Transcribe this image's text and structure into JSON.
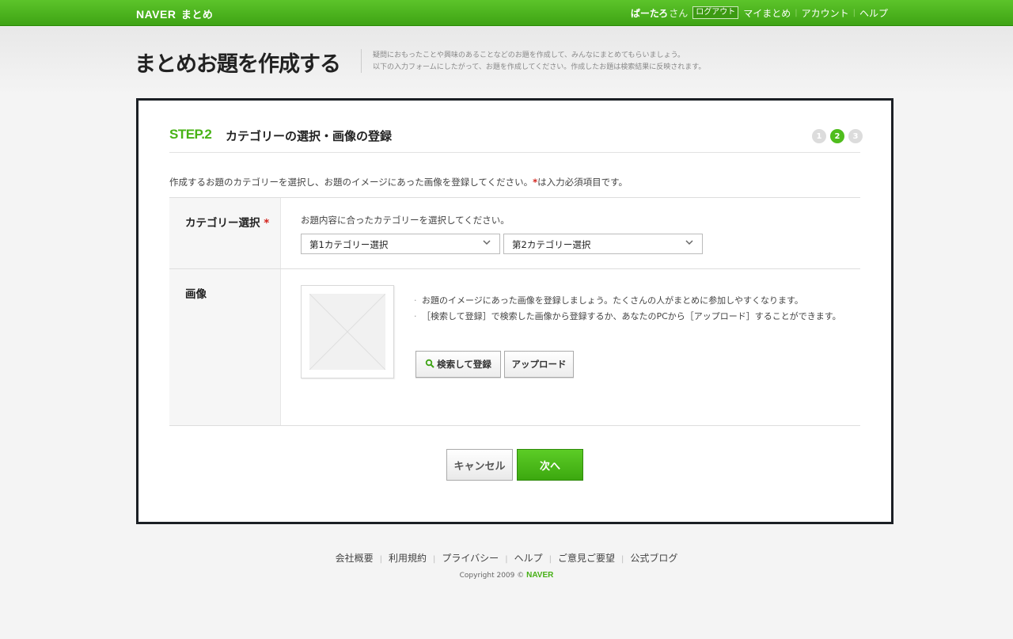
{
  "topbar": {
    "logo_naver": "NAVER",
    "logo_matome": "まとめ",
    "username": "ぱーたろ",
    "san": "さん",
    "logout": "ログアウト",
    "links": [
      "マイまとめ",
      "アカウント",
      "ヘルプ"
    ]
  },
  "header": {
    "title": "まとめお題を作成する",
    "desc_line1": "疑問におもったことや興味のあることなどのお題を作成して、みんなにまとめてもらいましょう。",
    "desc_line2": "以下の入力フォームにしたがって、お題を作成してください。作成したお題は検索結果に反映されます。"
  },
  "step": {
    "label": "STEP.2",
    "title": "カテゴリーの選択・画像の登録",
    "indicators": [
      "1",
      "2",
      "3"
    ],
    "active_index": 1
  },
  "intro": {
    "text": "作成するお題のカテゴリーを選択し、お題のイメージにあった画像を登録してください。",
    "req_mark": "*",
    "req_text": "は入力必須項目です。"
  },
  "category": {
    "label": "カテゴリー選択",
    "req_mark": "*",
    "hint": "お題内容に合ったカテゴリーを選択してください。",
    "select1": "第1カテゴリー選択",
    "select2": "第2カテゴリー選択"
  },
  "image": {
    "label": "画像",
    "note1": "お題のイメージにあった画像を登録しましょう。たくさんの人がまとめに参加しやすくなります。",
    "note2": "［検索して登録］で検索した画像から登録するか、あなたのPCから［アップロード］することができます。",
    "search_btn": "検索して登録",
    "upload_btn": "アップロード"
  },
  "actions": {
    "cancel": "キャンセル",
    "next": "次へ"
  },
  "footer": {
    "links": [
      "会社概要",
      "利用規約",
      "プライバシー",
      "ヘルプ",
      "ご意見ご要望",
      "公式ブログ"
    ],
    "copyright": "Copyright 2009 ©",
    "brand": "NAVER"
  },
  "colors": {
    "accent_green": "#4fbd1d",
    "required_red": "#d3221b",
    "box_border": "#1b1f24"
  }
}
